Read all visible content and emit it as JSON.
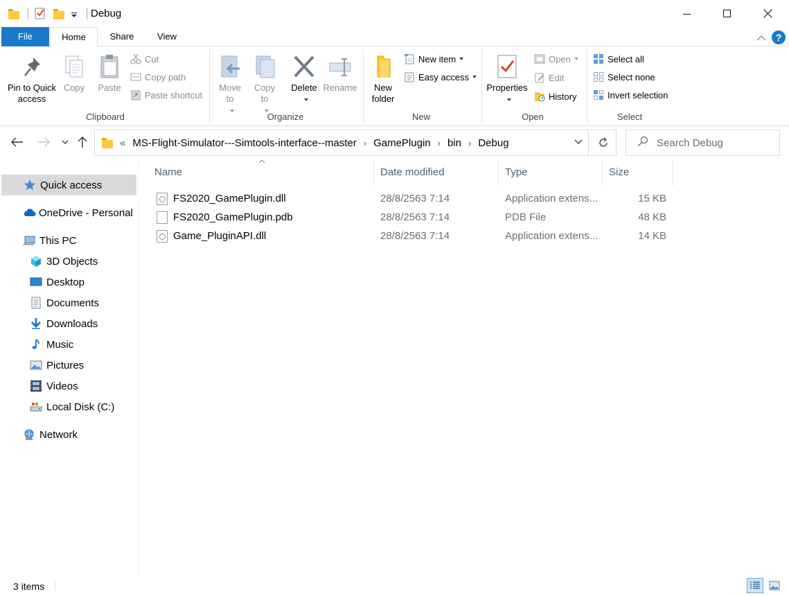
{
  "window": {
    "title": "Debug",
    "minimize": "—",
    "maximize": "☐",
    "close": "✕"
  },
  "tabs": {
    "file": "File",
    "home": "Home",
    "share": "Share",
    "view": "View",
    "help": "?"
  },
  "ribbon": {
    "clipboard": {
      "label": "Clipboard",
      "pin": "Pin to Quick access",
      "copy": "Copy",
      "paste": "Paste",
      "cut": "Cut",
      "copy_path": "Copy path",
      "paste_shortcut": "Paste shortcut"
    },
    "organize": {
      "label": "Organize",
      "move_to": "Move to",
      "copy_to": "Copy to",
      "delete": "Delete",
      "rename": "Rename"
    },
    "new": {
      "label": "New",
      "new_folder": "New folder",
      "new_item": "New item",
      "easy_access": "Easy access"
    },
    "open": {
      "label": "Open",
      "properties": "Properties",
      "open": "Open",
      "edit": "Edit",
      "history": "History"
    },
    "select": {
      "label": "Select",
      "select_all": "Select all",
      "select_none": "Select none",
      "invert_selection": "Invert selection"
    }
  },
  "address": {
    "overflow": "«",
    "crumbs": [
      "MS-Flight-Simulator---Simtools-interface--master",
      "GamePlugin",
      "bin",
      "Debug"
    ]
  },
  "search": {
    "placeholder": "Search Debug"
  },
  "sidebar": {
    "items": [
      {
        "label": "Quick access"
      },
      {
        "label": "OneDrive - Personal"
      },
      {
        "label": "This PC"
      },
      {
        "label": "3D Objects"
      },
      {
        "label": "Desktop"
      },
      {
        "label": "Documents"
      },
      {
        "label": "Downloads"
      },
      {
        "label": "Music"
      },
      {
        "label": "Pictures"
      },
      {
        "label": "Videos"
      },
      {
        "label": "Local Disk (C:)"
      },
      {
        "label": "Network"
      }
    ]
  },
  "columns": {
    "name": "Name",
    "date": "Date modified",
    "type": "Type",
    "size": "Size"
  },
  "files": [
    {
      "name": "FS2020_GamePlugin.dll",
      "date": "28/8/2563 7:14",
      "type": "Application extens...",
      "size": "15 KB"
    },
    {
      "name": "FS2020_GamePlugin.pdb",
      "date": "28/8/2563 7:14",
      "type": "PDB File",
      "size": "48 KB"
    },
    {
      "name": "Game_PluginAPI.dll",
      "date": "28/8/2563 7:14",
      "type": "Application extens...",
      "size": "14 KB"
    }
  ],
  "status": {
    "count": "3 items"
  },
  "colors": {
    "accent": "#1979ca",
    "folder": "#ffc83d",
    "selected": "#d9d9d9"
  }
}
